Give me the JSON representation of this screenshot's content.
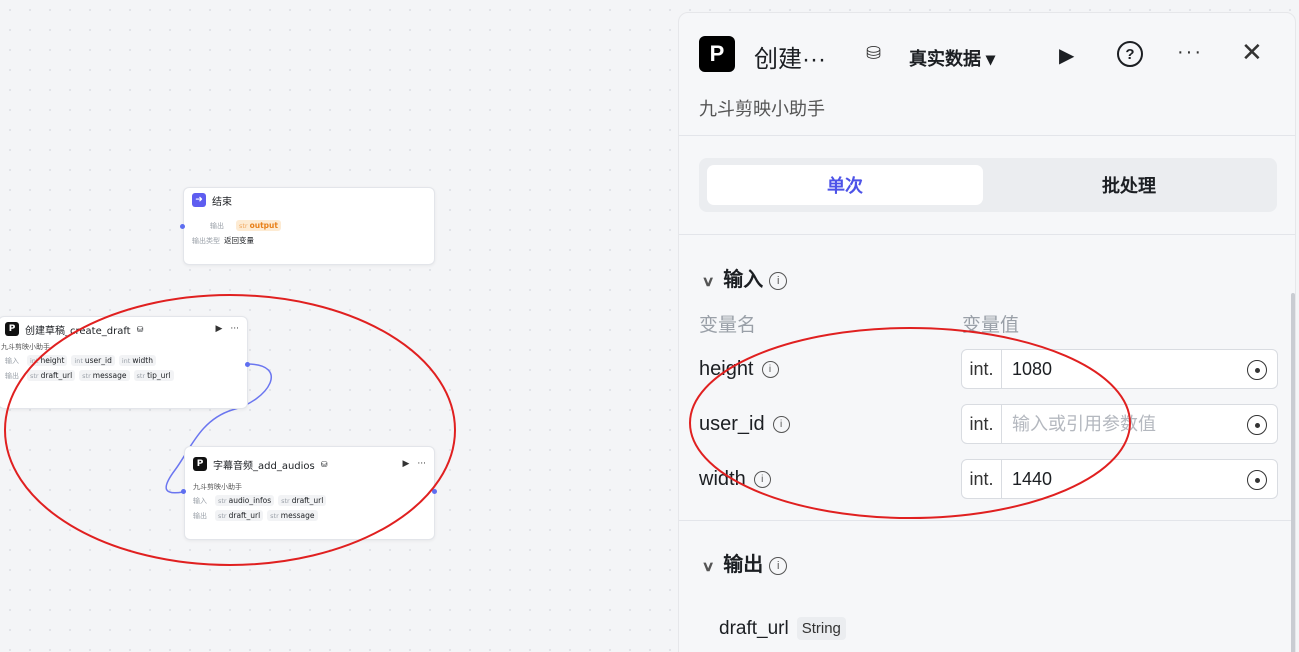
{
  "canvas": {
    "end_node": {
      "title": "结束",
      "output_label": "输出",
      "output_var": "output",
      "output_type_label": "输出类型",
      "output_type_value": "返回变量",
      "var_type": "str"
    },
    "create_draft_node": {
      "title": "创建草稿_create_draft",
      "subtitle": "九斗剪映小助手",
      "input_label": "输入",
      "output_label": "输出",
      "inputs": [
        {
          "type": "int",
          "name": "height"
        },
        {
          "type": "int",
          "name": "user_id"
        },
        {
          "type": "int",
          "name": "width"
        }
      ],
      "outputs": [
        {
          "type": "str",
          "name": "draft_url"
        },
        {
          "type": "str",
          "name": "message"
        },
        {
          "type": "str",
          "name": "tip_url"
        }
      ]
    },
    "add_audios_node": {
      "title": "字幕音频_add_audios",
      "subtitle": "九斗剪映小助手",
      "input_label": "输入",
      "output_label": "输出",
      "inputs": [
        {
          "type": "str",
          "name": "audio_infos"
        },
        {
          "type": "str",
          "name": "draft_url"
        }
      ],
      "outputs": [
        {
          "type": "str",
          "name": "draft_url"
        },
        {
          "type": "str",
          "name": "message"
        }
      ]
    },
    "node_more": "···",
    "node_run": "▶"
  },
  "panel": {
    "logo_text": "P",
    "title": "创建···",
    "mode": "真实数据 ▾",
    "play": "▶",
    "help": "?",
    "more": "···",
    "close": "✕",
    "subtitle": "九斗剪映小助手",
    "tabs": [
      "单次",
      "批处理"
    ],
    "input_section": "输入",
    "col_name": "变量名",
    "col_value": "变量值",
    "params": [
      {
        "name": "height",
        "type": "int.",
        "value": "1080",
        "placeholder": ""
      },
      {
        "name": "user_id",
        "type": "int.",
        "value": "",
        "placeholder": "输入或引用参数值"
      },
      {
        "name": "width",
        "type": "int.",
        "value": "1440",
        "placeholder": ""
      }
    ],
    "output_section": "输出",
    "outputs": [
      {
        "name": "draft_url",
        "type": "String"
      }
    ],
    "info": "i",
    "chevron": "∨"
  },
  "colors": {
    "accent": "#4d53e8",
    "annotation": "#e02020",
    "wire": "#6b76f0"
  }
}
